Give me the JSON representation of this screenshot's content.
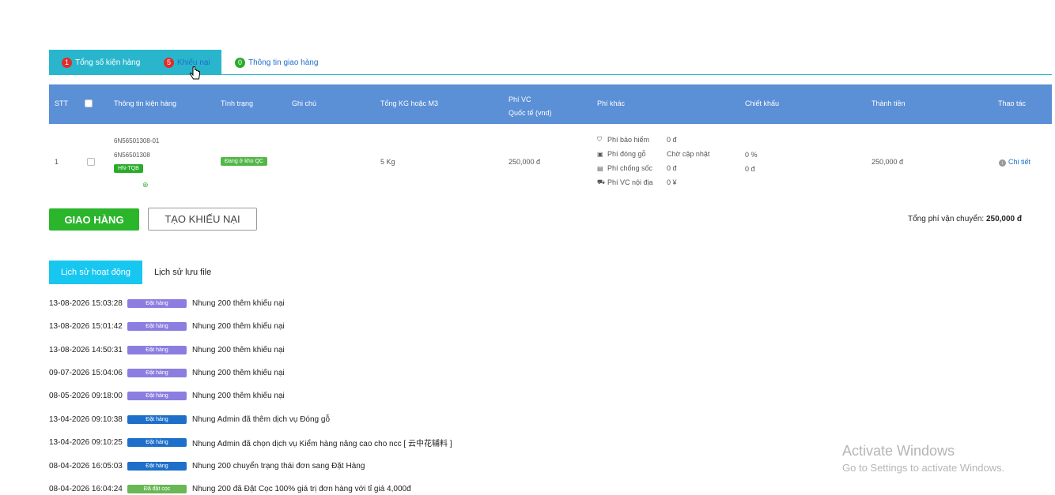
{
  "tabs": [
    {
      "count": "1",
      "label": "Tổng số kiện hàng"
    },
    {
      "count": "5",
      "label": "Khiếu nại"
    },
    {
      "count": "0",
      "label": "Thông tin giao hàng"
    }
  ],
  "table": {
    "headers": {
      "stt": "STT",
      "info": "Thông tin kiện hàng",
      "status": "Tình trạng",
      "note": "Ghi chú",
      "weight": "Tổng KG hoặc M3",
      "fee_line1": "Phí VC",
      "fee_line2": "Quốc tế (vnd)",
      "other_fee": "Phí khác",
      "discount": "Chiết khấu",
      "amount": "Thành tiền",
      "action": "Thao tác"
    },
    "row": {
      "stt": "1",
      "code1": "6N56501308-01",
      "code2": "6N56501308",
      "route": "HN-TQB",
      "status": "Đang ở kho QC",
      "weight": "5 Kg",
      "intl_fee": "250,000 đ",
      "fees": [
        {
          "icon": "shield-icon",
          "label": "Phí bảo hiểm",
          "value": "0 đ"
        },
        {
          "icon": "box-icon",
          "label": "Phí đóng gỗ",
          "value": "Chờ cập nhật"
        },
        {
          "icon": "document-icon",
          "label": "Phí chống sốc",
          "value": "0 đ"
        },
        {
          "icon": "truck-icon",
          "label": "Phí VC nội địa",
          "value": "0 ¥"
        }
      ],
      "discount_pct": "0 %",
      "discount_val": "0 đ",
      "amount": "250,000 đ",
      "action": "Chi tiết"
    }
  },
  "buttons": {
    "ship": "GIAO HÀNG",
    "claim": "TẠO KHIẾU NẠI"
  },
  "total": {
    "label": "Tổng phí vận chuyển:",
    "value": "250,000 đ"
  },
  "history_tabs": {
    "active": "Lịch sử hoạt động",
    "other": "Lịch sử lưu file"
  },
  "logs": [
    {
      "time": "13-08-2026 15:03:28",
      "tag": "Đặt hàng",
      "color": "purple",
      "text": "Nhung 200 thêm khiếu nại"
    },
    {
      "time": "13-08-2026 15:01:42",
      "tag": "Đặt hàng",
      "color": "purple",
      "text": "Nhung 200 thêm khiếu nại"
    },
    {
      "time": "13-08-2026 14:50:31",
      "tag": "Đặt hàng",
      "color": "purple",
      "text": "Nhung 200 thêm khiếu nại"
    },
    {
      "time": "09-07-2026 15:04:06",
      "tag": "Đặt hàng",
      "color": "purple",
      "text": "Nhung 200 thêm khiếu nại"
    },
    {
      "time": "08-05-2026 09:18:00",
      "tag": "Đặt hàng",
      "color": "purple",
      "text": "Nhung 200 thêm khiếu nại"
    },
    {
      "time": "13-04-2026 09:10:38",
      "tag": "Đặt hàng",
      "color": "blue",
      "text": "Nhung Admin đã thêm dịch vụ Đóng gỗ"
    },
    {
      "time": "13-04-2026 09:10:25",
      "tag": "Đặt hàng",
      "color": "blue",
      "text": "Nhung Admin đã chọn dịch vụ Kiểm hàng nâng cao cho ncc [ 云中花辅料 ]"
    },
    {
      "time": "08-04-2026 16:05:03",
      "tag": "Đặt hàng",
      "color": "blue",
      "text": "Nhung 200 chuyển trạng thái đơn sang Đặt Hàng"
    },
    {
      "time": "08-04-2026 16:04:24",
      "tag": "Đã đặt cọc",
      "color": "green",
      "text": "Nhung 200 đã Đặt Cọc 100% giá trị đơn hàng với tỉ giá 4,000đ"
    }
  ],
  "watermark": {
    "line1": "Activate Windows",
    "line2": "Go to Settings to activate Windows."
  }
}
